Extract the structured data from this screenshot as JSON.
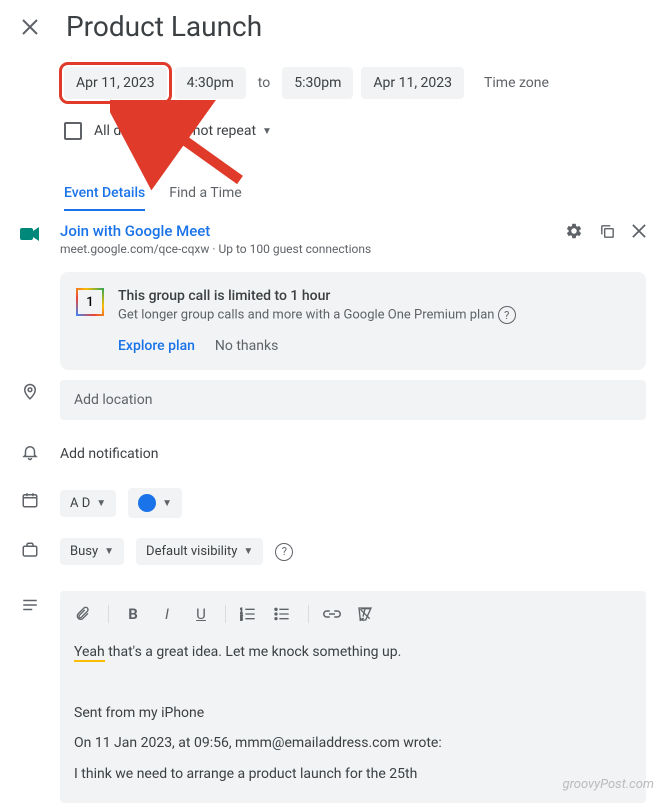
{
  "title": "Product Launch",
  "datetime": {
    "start_date": "Apr 11, 2023",
    "start_time": "4:30pm",
    "separator": "to",
    "end_time": "5:30pm",
    "end_date": "Apr 11, 2023",
    "timezone_label": "Time zone"
  },
  "allday": {
    "label": "All day",
    "repeat": "Does not repeat"
  },
  "tabs": {
    "details": "Event Details",
    "findtime": "Find a Time"
  },
  "meet": {
    "link_text": "Join with Google Meet",
    "url": "meet.google.com/qce-cqxw",
    "sub": " · Up to 100 guest connections"
  },
  "promo": {
    "title": "This group call is limited to 1 hour",
    "sub": "Get longer group calls and more with a Google One Premium plan",
    "explore": "Explore plan",
    "dismiss": "No thanks"
  },
  "location": {
    "placeholder": "Add location"
  },
  "notification": {
    "label": "Add notification"
  },
  "calendar": {
    "owner": "A D"
  },
  "availability": {
    "busy": "Busy",
    "visibility": "Default visibility"
  },
  "description": {
    "line1_highlight": "Yeah",
    "line1_rest": " that's a great idea. Let me knock something up.",
    "sig": "Sent from my iPhone",
    "quote_header": "On 11 Jan 2023, at 09:56, mmm@emailaddress.com wrote:",
    "quote_body": "I think we need to arrange a product launch for the 25th"
  },
  "watermark": "groovyPost.com"
}
